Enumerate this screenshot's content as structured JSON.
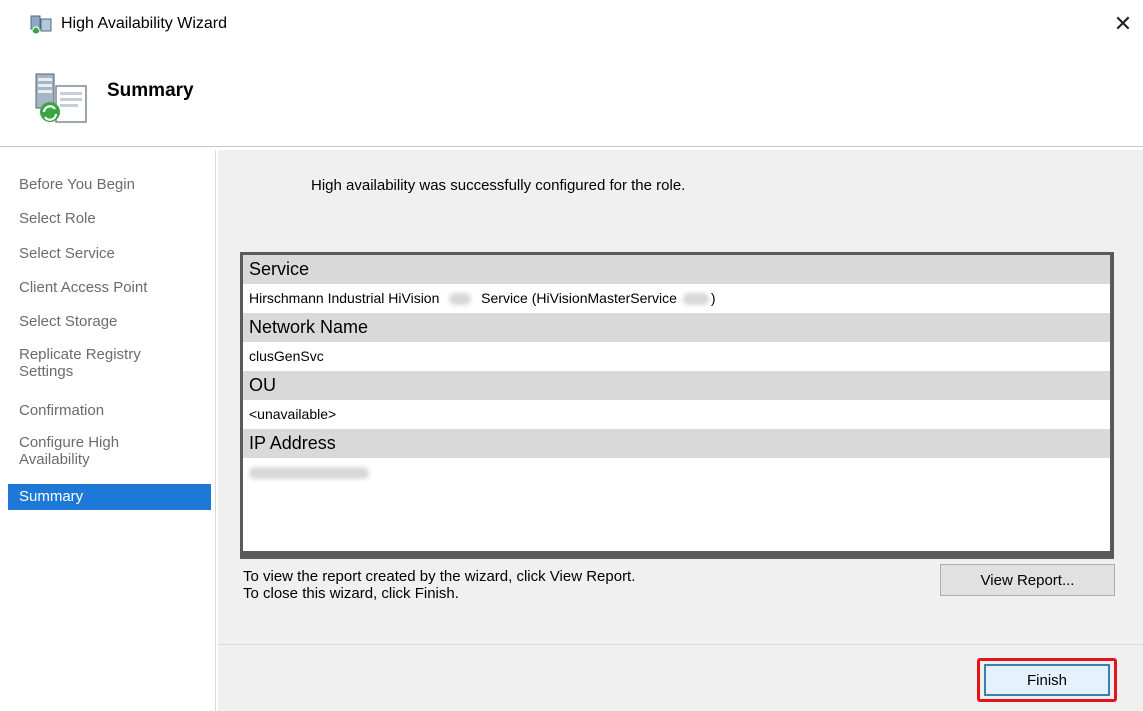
{
  "window": {
    "title": "High Availability Wizard",
    "close_icon": "close-icon",
    "app_icon": "cluster-wizard-icon"
  },
  "header": {
    "title": "Summary",
    "icon": "server-summary-icon"
  },
  "nav": {
    "items": [
      {
        "label": "Before You Begin"
      },
      {
        "label": "Select Role"
      },
      {
        "label": "Select Service"
      },
      {
        "label": "Client Access Point"
      },
      {
        "label": "Select Storage"
      },
      {
        "label": "Replicate Registry Settings"
      },
      {
        "label": "Confirmation"
      },
      {
        "label": "Configure High Availability"
      },
      {
        "label": "Summary"
      }
    ],
    "active_index": 8
  },
  "main": {
    "success_message": "High availability was successfully configured for the role.",
    "report": {
      "service_heading": "Service",
      "service_value_prefix": "Hirschmann Industrial HiVision",
      "service_value_middle": "Service (HiVisionMasterService",
      "service_value_suffix": ")",
      "network_name_heading": "Network Name",
      "network_name_value": "clusGenSvc",
      "ou_heading": "OU",
      "ou_value": "<unavailable>",
      "ip_heading": "IP Address"
    },
    "hint_line_1": "To view the report created by the wizard, click View Report.",
    "hint_line_2": "To close this wizard, click Finish.",
    "view_report_label": "View Report..."
  },
  "footer": {
    "finish_label": "Finish"
  },
  "colors": {
    "active_nav": "#1e78d7",
    "highlight": "#e3141b",
    "content_bg": "#f0f0f0"
  }
}
